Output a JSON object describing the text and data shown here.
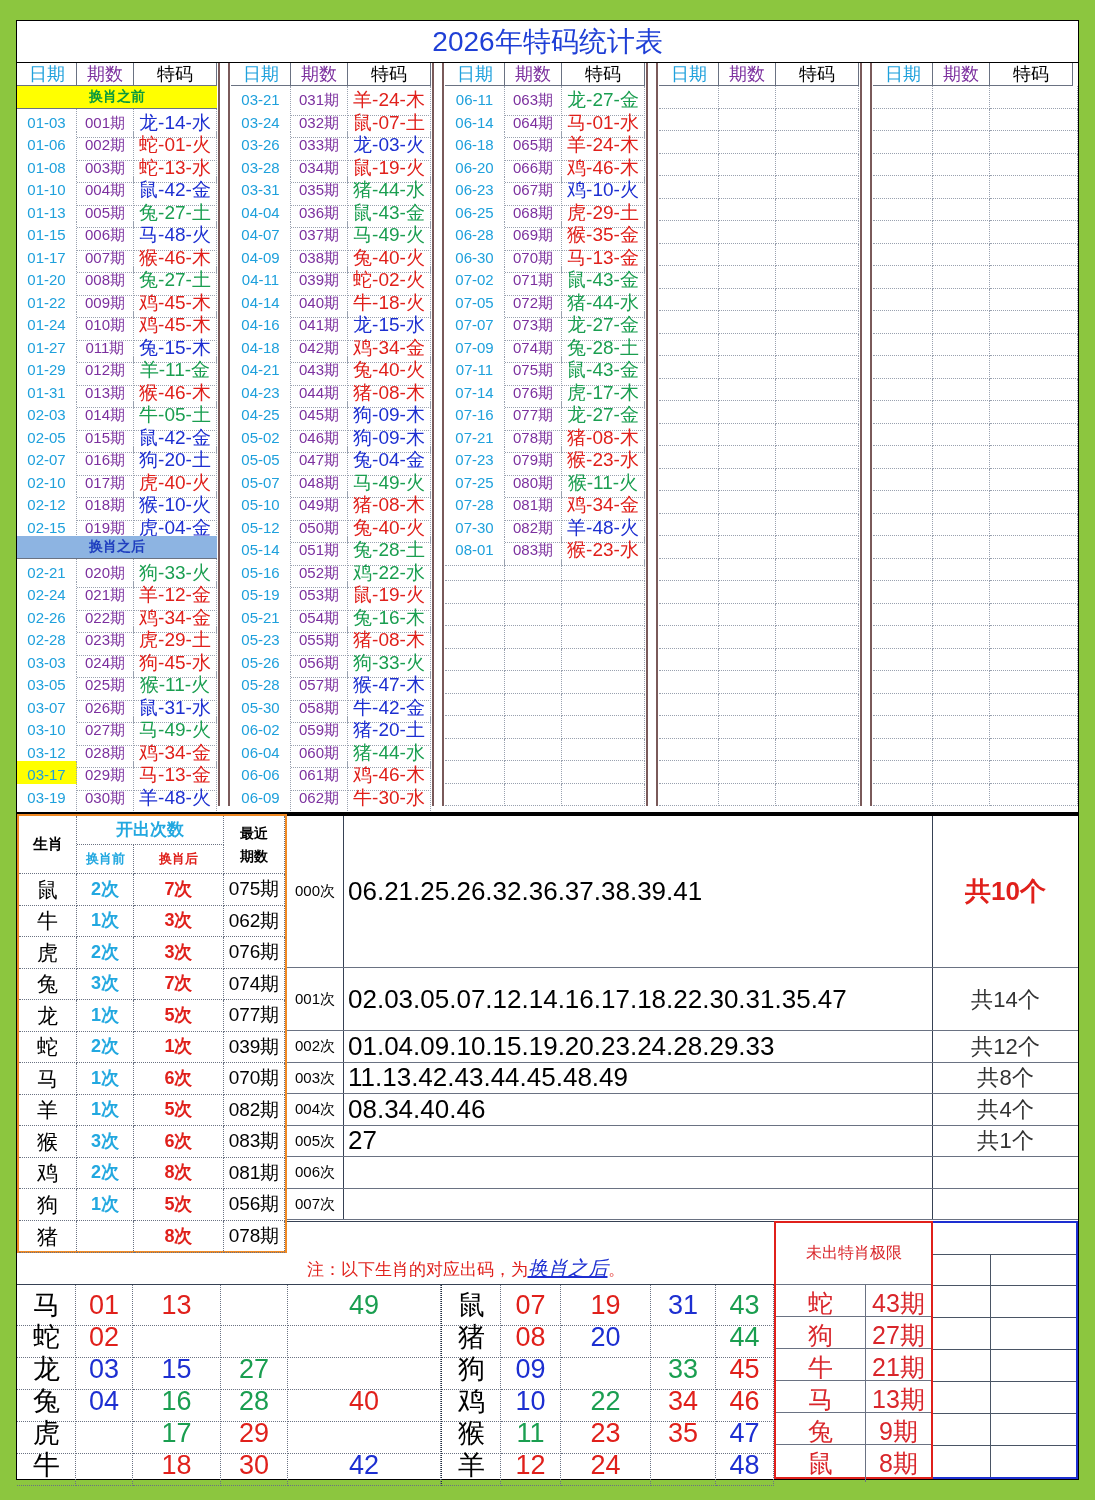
{
  "title": "2026年特码统计表",
  "blocks": [
    {
      "headers": [
        "日期",
        "期数",
        "特码"
      ],
      "rows": [
        {
          "kind": "label",
          "text": "换肖之前",
          "color": "#ffff00"
        },
        {
          "kind": "entry",
          "date": "01-03",
          "period": "001期",
          "code": "龙-14-水",
          "color": "#1d2fd1",
          "highlighted": false
        },
        {
          "kind": "entry",
          "date": "01-06",
          "period": "002期",
          "code": "蛇-01-火",
          "color": "#e0201b",
          "highlighted": false
        },
        {
          "kind": "entry",
          "date": "01-08",
          "period": "003期",
          "code": "蛇-13-水",
          "color": "#e0201b",
          "highlighted": false
        },
        {
          "kind": "entry",
          "date": "01-10",
          "period": "004期",
          "code": "鼠-42-金",
          "color": "#1d2fd1",
          "highlighted": false
        },
        {
          "kind": "entry",
          "date": "01-13",
          "period": "005期",
          "code": "兔-27-土",
          "color": "#1a9e50",
          "highlighted": false
        },
        {
          "kind": "entry",
          "date": "01-15",
          "period": "006期",
          "code": "马-48-火",
          "color": "#1d2fd1",
          "highlighted": false
        },
        {
          "kind": "entry",
          "date": "01-17",
          "period": "007期",
          "code": "猴-46-木",
          "color": "#e0201b",
          "highlighted": false
        },
        {
          "kind": "entry",
          "date": "01-20",
          "period": "008期",
          "code": "兔-27-土",
          "color": "#1a9e50",
          "highlighted": false
        },
        {
          "kind": "entry",
          "date": "01-22",
          "period": "009期",
          "code": "鸡-45-木",
          "color": "#e0201b",
          "highlighted": false
        },
        {
          "kind": "entry",
          "date": "01-24",
          "period": "010期",
          "code": "鸡-45-木",
          "color": "#e0201b",
          "highlighted": false
        },
        {
          "kind": "entry",
          "date": "01-27",
          "period": "011期",
          "code": "兔-15-木",
          "color": "#1d2fd1",
          "highlighted": false
        },
        {
          "kind": "entry",
          "date": "01-29",
          "period": "012期",
          "code": "羊-11-金",
          "color": "#1a9e50",
          "highlighted": false
        },
        {
          "kind": "entry",
          "date": "01-31",
          "period": "013期",
          "code": "猴-46-木",
          "color": "#e0201b",
          "highlighted": false
        },
        {
          "kind": "entry",
          "date": "02-03",
          "period": "014期",
          "code": "牛-05-土",
          "color": "#1a9e50",
          "highlighted": false
        },
        {
          "kind": "entry",
          "date": "02-05",
          "period": "015期",
          "code": "鼠-42-金",
          "color": "#1d2fd1",
          "highlighted": false
        },
        {
          "kind": "entry",
          "date": "02-07",
          "period": "016期",
          "code": "狗-20-土",
          "color": "#1d2fd1",
          "highlighted": false
        },
        {
          "kind": "entry",
          "date": "02-10",
          "period": "017期",
          "code": "虎-40-火",
          "color": "#e0201b",
          "highlighted": false
        },
        {
          "kind": "entry",
          "date": "02-12",
          "period": "018期",
          "code": "猴-10-火",
          "color": "#1d2fd1",
          "highlighted": false
        },
        {
          "kind": "entry",
          "date": "02-15",
          "period": "019期",
          "code": "虎-04-金",
          "color": "#1d2fd1",
          "highlighted": false
        },
        {
          "kind": "label",
          "text": "换肖之后",
          "color": "#8db4e2"
        },
        {
          "kind": "entry",
          "date": "02-21",
          "period": "020期",
          "code": "狗-33-火",
          "color": "#1a9e50",
          "highlighted": false
        },
        {
          "kind": "entry",
          "date": "02-24",
          "period": "021期",
          "code": "羊-12-金",
          "color": "#e0201b",
          "highlighted": false
        },
        {
          "kind": "entry",
          "date": "02-26",
          "period": "022期",
          "code": "鸡-34-金",
          "color": "#e0201b",
          "highlighted": false
        },
        {
          "kind": "entry",
          "date": "02-28",
          "period": "023期",
          "code": "虎-29-土",
          "color": "#e0201b",
          "highlighted": false
        },
        {
          "kind": "entry",
          "date": "03-03",
          "period": "024期",
          "code": "狗-45-水",
          "color": "#e0201b",
          "highlighted": false
        },
        {
          "kind": "entry",
          "date": "03-05",
          "period": "025期",
          "code": "猴-11-火",
          "color": "#1a9e50",
          "highlighted": false
        },
        {
          "kind": "entry",
          "date": "03-07",
          "period": "026期",
          "code": "鼠-31-水",
          "color": "#1d2fd1",
          "highlighted": false
        },
        {
          "kind": "entry",
          "date": "03-10",
          "period": "027期",
          "code": "马-49-火",
          "color": "#1a9e50",
          "highlighted": false
        },
        {
          "kind": "entry",
          "date": "03-12",
          "period": "028期",
          "code": "鸡-34-金",
          "color": "#e0201b",
          "highlighted": false
        },
        {
          "kind": "entry",
          "date": "03-17",
          "period": "029期",
          "code": "马-13-金",
          "color": "#e0201b",
          "highlighted": true
        },
        {
          "kind": "entry",
          "date": "03-19",
          "period": "030期",
          "code": "羊-48-火",
          "color": "#1d2fd1",
          "highlighted": false
        }
      ]
    },
    {
      "headers": [
        "日期",
        "期数",
        "特码"
      ],
      "rows": [
        {
          "kind": "entry",
          "date": "03-21",
          "period": "031期",
          "code": "羊-24-木",
          "color": "#e0201b",
          "highlighted": false
        },
        {
          "kind": "entry",
          "date": "03-24",
          "period": "032期",
          "code": "鼠-07-土",
          "color": "#e0201b",
          "highlighted": false
        },
        {
          "kind": "entry",
          "date": "03-26",
          "period": "033期",
          "code": "龙-03-火",
          "color": "#1d2fd1",
          "highlighted": false
        },
        {
          "kind": "entry",
          "date": "03-28",
          "period": "034期",
          "code": "鼠-19-火",
          "color": "#e0201b",
          "highlighted": false
        },
        {
          "kind": "entry",
          "date": "03-31",
          "period": "035期",
          "code": "猪-44-水",
          "color": "#1a9e50",
          "highlighted": false
        },
        {
          "kind": "entry",
          "date": "04-04",
          "period": "036期",
          "code": "鼠-43-金",
          "color": "#1a9e50",
          "highlighted": false
        },
        {
          "kind": "entry",
          "date": "04-07",
          "period": "037期",
          "code": "马-49-火",
          "color": "#1a9e50",
          "highlighted": false
        },
        {
          "kind": "entry",
          "date": "04-09",
          "period": "038期",
          "code": "兔-40-火",
          "color": "#e0201b",
          "highlighted": false
        },
        {
          "kind": "entry",
          "date": "04-11",
          "period": "039期",
          "code": "蛇-02-火",
          "color": "#e0201b",
          "highlighted": false
        },
        {
          "kind": "entry",
          "date": "04-14",
          "period": "040期",
          "code": "牛-18-火",
          "color": "#e0201b",
          "highlighted": false
        },
        {
          "kind": "entry",
          "date": "04-16",
          "period": "041期",
          "code": "龙-15-水",
          "color": "#1d2fd1",
          "highlighted": false
        },
        {
          "kind": "entry",
          "date": "04-18",
          "period": "042期",
          "code": "鸡-34-金",
          "color": "#e0201b",
          "highlighted": false
        },
        {
          "kind": "entry",
          "date": "04-21",
          "period": "043期",
          "code": "兔-40-火",
          "color": "#e0201b",
          "highlighted": false
        },
        {
          "kind": "entry",
          "date": "04-23",
          "period": "044期",
          "code": "猪-08-木",
          "color": "#e0201b",
          "highlighted": false
        },
        {
          "kind": "entry",
          "date": "04-25",
          "period": "045期",
          "code": "狗-09-木",
          "color": "#1d2fd1",
          "highlighted": false
        },
        {
          "kind": "entry",
          "date": "05-02",
          "period": "046期",
          "code": "狗-09-木",
          "color": "#1d2fd1",
          "highlighted": false
        },
        {
          "kind": "entry",
          "date": "05-05",
          "period": "047期",
          "code": "兔-04-金",
          "color": "#1d2fd1",
          "highlighted": false
        },
        {
          "kind": "entry",
          "date": "05-07",
          "period": "048期",
          "code": "马-49-火",
          "color": "#1a9e50",
          "highlighted": false
        },
        {
          "kind": "entry",
          "date": "05-10",
          "period": "049期",
          "code": "猪-08-木",
          "color": "#e0201b",
          "highlighted": false
        },
        {
          "kind": "entry",
          "date": "05-12",
          "period": "050期",
          "code": "兔-40-火",
          "color": "#e0201b",
          "highlighted": false
        },
        {
          "kind": "entry",
          "date": "05-14",
          "period": "051期",
          "code": "兔-28-土",
          "color": "#1a9e50",
          "highlighted": false
        },
        {
          "kind": "entry",
          "date": "05-16",
          "period": "052期",
          "code": "鸡-22-水",
          "color": "#1a9e50",
          "highlighted": false
        },
        {
          "kind": "entry",
          "date": "05-19",
          "period": "053期",
          "code": "鼠-19-火",
          "color": "#e0201b",
          "highlighted": false
        },
        {
          "kind": "entry",
          "date": "05-21",
          "period": "054期",
          "code": "兔-16-木",
          "color": "#1a9e50",
          "highlighted": false
        },
        {
          "kind": "entry",
          "date": "05-23",
          "period": "055期",
          "code": "猪-08-木",
          "color": "#e0201b",
          "highlighted": false
        },
        {
          "kind": "entry",
          "date": "05-26",
          "period": "056期",
          "code": "狗-33-火",
          "color": "#1a9e50",
          "highlighted": false
        },
        {
          "kind": "entry",
          "date": "05-28",
          "period": "057期",
          "code": "猴-47-木",
          "color": "#1d2fd1",
          "highlighted": false
        },
        {
          "kind": "entry",
          "date": "05-30",
          "period": "058期",
          "code": "牛-42-金",
          "color": "#1d2fd1",
          "highlighted": false
        },
        {
          "kind": "entry",
          "date": "06-02",
          "period": "059期",
          "code": "猪-20-土",
          "color": "#1d2fd1",
          "highlighted": false
        },
        {
          "kind": "entry",
          "date": "06-04",
          "period": "060期",
          "code": "猪-44-水",
          "color": "#1a9e50",
          "highlighted": false
        },
        {
          "kind": "entry",
          "date": "06-06",
          "period": "061期",
          "code": "鸡-46-木",
          "color": "#e0201b",
          "highlighted": false
        },
        {
          "kind": "entry",
          "date": "06-09",
          "period": "062期",
          "code": "牛-30-水",
          "color": "#e0201b",
          "highlighted": false
        }
      ]
    },
    {
      "headers": [
        "日期",
        "期数",
        "特码"
      ],
      "rows": [
        {
          "kind": "entry",
          "date": "06-11",
          "period": "063期",
          "code": "龙-27-金",
          "color": "#1a9e50",
          "highlighted": false
        },
        {
          "kind": "entry",
          "date": "06-14",
          "period": "064期",
          "code": "马-01-水",
          "color": "#e0201b",
          "highlighted": false
        },
        {
          "kind": "entry",
          "date": "06-18",
          "period": "065期",
          "code": "羊-24-木",
          "color": "#e0201b",
          "highlighted": false
        },
        {
          "kind": "entry",
          "date": "06-20",
          "period": "066期",
          "code": "鸡-46-木",
          "color": "#e0201b",
          "highlighted": false
        },
        {
          "kind": "entry",
          "date": "06-23",
          "period": "067期",
          "code": "鸡-10-火",
          "color": "#1d2fd1",
          "highlighted": false
        },
        {
          "kind": "entry",
          "date": "06-25",
          "period": "068期",
          "code": "虎-29-土",
          "color": "#e0201b",
          "highlighted": false
        },
        {
          "kind": "entry",
          "date": "06-28",
          "period": "069期",
          "code": "猴-35-金",
          "color": "#e0201b",
          "highlighted": false
        },
        {
          "kind": "entry",
          "date": "06-30",
          "period": "070期",
          "code": "马-13-金",
          "color": "#e0201b",
          "highlighted": false
        },
        {
          "kind": "entry",
          "date": "07-02",
          "period": "071期",
          "code": "鼠-43-金",
          "color": "#1a9e50",
          "highlighted": false
        },
        {
          "kind": "entry",
          "date": "07-05",
          "period": "072期",
          "code": "猪-44-水",
          "color": "#1a9e50",
          "highlighted": false
        },
        {
          "kind": "entry",
          "date": "07-07",
          "period": "073期",
          "code": "龙-27-金",
          "color": "#1a9e50",
          "highlighted": false
        },
        {
          "kind": "entry",
          "date": "07-09",
          "period": "074期",
          "code": "兔-28-土",
          "color": "#1a9e50",
          "highlighted": false
        },
        {
          "kind": "entry",
          "date": "07-11",
          "period": "075期",
          "code": "鼠-43-金",
          "color": "#1a9e50",
          "highlighted": false
        },
        {
          "kind": "entry",
          "date": "07-14",
          "period": "076期",
          "code": "虎-17-木",
          "color": "#1a9e50",
          "highlighted": false
        },
        {
          "kind": "entry",
          "date": "07-16",
          "period": "077期",
          "code": "龙-27-金",
          "color": "#1a9e50",
          "highlighted": false
        },
        {
          "kind": "entry",
          "date": "07-21",
          "period": "078期",
          "code": "猪-08-木",
          "color": "#e0201b",
          "highlighted": false
        },
        {
          "kind": "entry",
          "date": "07-23",
          "period": "079期",
          "code": "猴-23-水",
          "color": "#e0201b",
          "highlighted": false
        },
        {
          "kind": "entry",
          "date": "07-25",
          "period": "080期",
          "code": "猴-11-火",
          "color": "#1a9e50",
          "highlighted": false
        },
        {
          "kind": "entry",
          "date": "07-28",
          "period": "081期",
          "code": "鸡-34-金",
          "color": "#e0201b",
          "highlighted": false
        },
        {
          "kind": "entry",
          "date": "07-30",
          "period": "082期",
          "code": "羊-48-火",
          "color": "#1d2fd1",
          "highlighted": false
        },
        {
          "kind": "entry",
          "date": "08-01",
          "period": "083期",
          "code": "猴-23-水",
          "color": "#e0201b",
          "highlighted": false
        }
      ]
    },
    {
      "headers": [
        "日期",
        "期数",
        "特码"
      ]
    },
    {
      "headers": [
        "日期",
        "期数",
        "特码"
      ]
    }
  ],
  "zodiac_stats": {
    "headers": {
      "zodiac": "生肖",
      "group": "开出次数",
      "before": "换肖前",
      "after": "换肖后",
      "recent": "最近期数"
    },
    "rows": [
      {
        "zodiac": "鼠",
        "before": "2次",
        "after": "7次",
        "recent": "075期"
      },
      {
        "zodiac": "牛",
        "before": "1次",
        "after": "3次",
        "recent": "062期"
      },
      {
        "zodiac": "虎",
        "before": "2次",
        "after": "3次",
        "recent": "076期"
      },
      {
        "zodiac": "兔",
        "before": "3次",
        "after": "7次",
        "recent": "074期"
      },
      {
        "zodiac": "龙",
        "before": "1次",
        "after": "5次",
        "recent": "077期"
      },
      {
        "zodiac": "蛇",
        "before": "2次",
        "after": "1次",
        "recent": "039期"
      },
      {
        "zodiac": "马",
        "before": "1次",
        "after": "6次",
        "recent": "070期"
      },
      {
        "zodiac": "羊",
        "before": "1次",
        "after": "5次",
        "recent": "082期"
      },
      {
        "zodiac": "猴",
        "before": "3次",
        "after": "6次",
        "recent": "083期"
      },
      {
        "zodiac": "鸡",
        "before": "2次",
        "after": "8次",
        "recent": "081期"
      },
      {
        "zodiac": "狗",
        "before": "1次",
        "after": "5次",
        "recent": "056期"
      },
      {
        "zodiac": "猪",
        "after": "8次",
        "recent": "078期"
      }
    ]
  },
  "count_rows": [
    {
      "label": "000次",
      "numbers": "06.21.25.26.32.36.37.38.39.41",
      "total": "共10个",
      "emphasis": true
    },
    {
      "label": "001次",
      "numbers": "02.03.05.07.12.14.16.17.18.22.30.31.35.47",
      "total": "共14个",
      "emphasis": false
    },
    {
      "label": "002次",
      "numbers": "01.04.09.10.15.19.20.23.24.28.29.33",
      "total": "共12个",
      "emphasis": false
    },
    {
      "label": "003次",
      "numbers": "11.13.42.43.44.45.48.49",
      "total": "共8个",
      "emphasis": false
    },
    {
      "label": "004次",
      "numbers": "08.34.40.46",
      "total": "共4个",
      "emphasis": false
    },
    {
      "label": "005次",
      "numbers": "27",
      "total": "共1个",
      "emphasis": false
    },
    {
      "label": "006次"
    },
    {
      "label": "007次"
    }
  ],
  "note": {
    "text": "注：以下生肖的对应出码，为",
    "link": "换肖之后",
    "end": "。"
  },
  "zodiac_numbers": [
    {
      "left": {
        "zodiac": "马",
        "n1": {
          "text": "01",
          "color": "#e0201b"
        },
        "n2": {
          "text": "13",
          "color": "#e0201b"
        },
        "n4": {
          "text": "49",
          "color": "#1a9e50"
        }
      },
      "right": {
        "zodiac": "鼠",
        "n1": {
          "text": "07",
          "color": "#e0201b"
        },
        "n2": {
          "text": "19",
          "color": "#e0201b"
        },
        "n3": {
          "text": "31",
          "color": "#1d2fd1"
        },
        "n4": {
          "text": "43",
          "color": "#1a9e50"
        }
      }
    },
    {
      "left": {
        "zodiac": "蛇",
        "n1": {
          "text": "02",
          "color": "#e0201b"
        }
      },
      "right": {
        "zodiac": "猪",
        "n1": {
          "text": "08",
          "color": "#e0201b"
        },
        "n2": {
          "text": "20",
          "color": "#1d2fd1"
        },
        "n4": {
          "text": "44",
          "color": "#1a9e50"
        }
      }
    },
    {
      "left": {
        "zodiac": "龙",
        "n1": {
          "text": "03",
          "color": "#1d2fd1"
        },
        "n2": {
          "text": "15",
          "color": "#1d2fd1"
        },
        "n3": {
          "text": "27",
          "color": "#1a9e50"
        }
      },
      "right": {
        "zodiac": "狗",
        "n1": {
          "text": "09",
          "color": "#1d2fd1"
        },
        "n3": {
          "text": "33",
          "color": "#1a9e50"
        },
        "n4": {
          "text": "45",
          "color": "#e0201b"
        }
      }
    },
    {
      "left": {
        "zodiac": "兔",
        "n1": {
          "text": "04",
          "color": "#1d2fd1"
        },
        "n2": {
          "text": "16",
          "color": "#1a9e50"
        },
        "n3": {
          "text": "28",
          "color": "#1a9e50"
        },
        "n4": {
          "text": "40",
          "color": "#e0201b"
        }
      },
      "right": {
        "zodiac": "鸡",
        "n1": {
          "text": "10",
          "color": "#1d2fd1"
        },
        "n2": {
          "text": "22",
          "color": "#1a9e50"
        },
        "n3": {
          "text": "34",
          "color": "#e0201b"
        },
        "n4": {
          "text": "46",
          "color": "#e0201b"
        }
      }
    },
    {
      "left": {
        "zodiac": "虎",
        "n2": {
          "text": "17",
          "color": "#1a9e50"
        },
        "n3": {
          "text": "29",
          "color": "#e0201b"
        }
      },
      "right": {
        "zodiac": "猴",
        "n1": {
          "text": "11",
          "color": "#1a9e50"
        },
        "n2": {
          "text": "23",
          "color": "#e0201b"
        },
        "n3": {
          "text": "35",
          "color": "#e0201b"
        },
        "n4": {
          "text": "47",
          "color": "#1d2fd1"
        }
      }
    },
    {
      "left": {
        "zodiac": "牛",
        "n2": {
          "text": "18",
          "color": "#e0201b"
        },
        "n3": {
          "text": "30",
          "color": "#e0201b"
        },
        "n4": {
          "text": "42",
          "color": "#1d2fd1"
        }
      },
      "right": {
        "zodiac": "羊",
        "n1": {
          "text": "12",
          "color": "#e0201b"
        },
        "n2": {
          "text": "24",
          "color": "#e0201b"
        },
        "n4": {
          "text": "48",
          "color": "#1d2fd1"
        }
      }
    }
  ],
  "absence_limit": {
    "title": "未出特肖极限",
    "rows": [
      {
        "zodiac": "蛇",
        "periods": "43期"
      },
      {
        "zodiac": "狗",
        "periods": "27期"
      },
      {
        "zodiac": "牛",
        "periods": "21期"
      },
      {
        "zodiac": "马",
        "periods": "13期"
      },
      {
        "zodiac": "兔",
        "periods": "9期"
      },
      {
        "zodiac": "鼠",
        "periods": "8期"
      }
    ]
  }
}
